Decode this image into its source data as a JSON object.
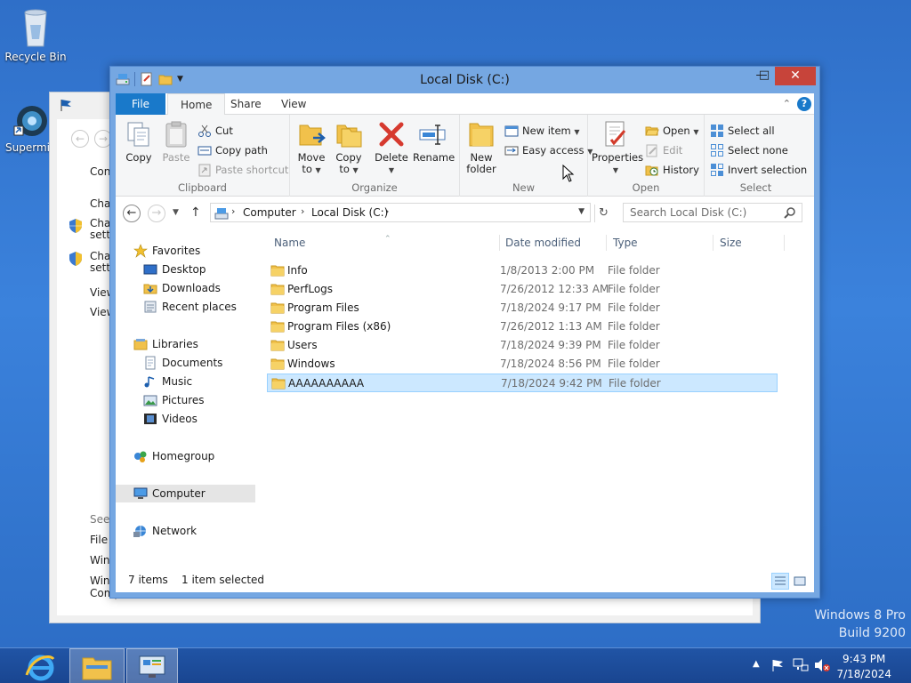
{
  "desktop": {
    "icons": [
      {
        "label": "Recycle Bin",
        "icon": "recycle-bin-icon"
      },
      {
        "label": "Supermi",
        "icon": "supermicro-icon"
      }
    ],
    "watermark": {
      "line1": "Windows 8 Pro",
      "line2": "Build 9200"
    }
  },
  "background_window": {
    "links": [
      "Contr",
      "Chang",
      "Chang settin",
      "Chang settin",
      "View a",
      "View p",
      "See al",
      "File H",
      "Windo",
      "Windo Comp"
    ]
  },
  "explorer": {
    "title": "Local Disk (C:)",
    "window_buttons": {
      "minimize": "—",
      "maximize": "□",
      "close": "✕"
    },
    "tabs": [
      "File",
      "Home",
      "Share",
      "View"
    ],
    "active_tab": "Home",
    "ribbon": {
      "clipboard": {
        "label": "Clipboard",
        "copy": "Copy",
        "paste": "Paste",
        "cut": "Cut",
        "copy_path": "Copy path",
        "paste_shortcut": "Paste shortcut"
      },
      "organize": {
        "label": "Organize",
        "move_to": "Move",
        "move_to_2": "to",
        "copy_to": "Copy",
        "copy_to_2": "to",
        "delete": "Delete",
        "rename": "Rename"
      },
      "new": {
        "label": "New",
        "new_folder": "New",
        "new_folder_2": "folder",
        "new_item": "New item",
        "easy_access": "Easy access"
      },
      "open": {
        "label": "Open",
        "properties": "Properties",
        "open": "Open",
        "edit": "Edit",
        "history": "History"
      },
      "select": {
        "label": "Select",
        "select_all": "Select all",
        "select_none": "Select none",
        "invert_selection": "Invert selection"
      }
    },
    "address": {
      "crumbs": [
        "Computer",
        "Local Disk (C:)"
      ]
    },
    "search": {
      "placeholder": "Search Local Disk (C:)"
    },
    "nav_pane": {
      "favorites": "Favorites",
      "desktop": "Desktop",
      "downloads": "Downloads",
      "recent_places": "Recent places",
      "libraries": "Libraries",
      "documents": "Documents",
      "music": "Music",
      "pictures": "Pictures",
      "videos": "Videos",
      "homegroup": "Homegroup",
      "computer": "Computer",
      "network": "Network"
    },
    "columns": {
      "name": "Name",
      "date": "Date modified",
      "type": "Type",
      "size": "Size"
    },
    "files": [
      {
        "name": "Info",
        "date": "1/8/2013 2:00 PM",
        "type": "File folder"
      },
      {
        "name": "PerfLogs",
        "date": "7/26/2012 12:33 AM",
        "type": "File folder"
      },
      {
        "name": "Program Files",
        "date": "7/18/2024 9:17 PM",
        "type": "File folder"
      },
      {
        "name": "Program Files (x86)",
        "date": "7/26/2012 1:13 AM",
        "type": "File folder"
      },
      {
        "name": "Users",
        "date": "7/18/2024 9:39 PM",
        "type": "File folder"
      },
      {
        "name": "Windows",
        "date": "7/18/2024 8:56 PM",
        "type": "File folder"
      },
      {
        "name": "AAAAAAAAAA",
        "date": "7/18/2024 9:42 PM",
        "type": "File folder",
        "selected": true
      }
    ],
    "status": {
      "items": "7 items",
      "selected": "1 item selected"
    }
  },
  "taskbar": {
    "clock_time": "9:43 PM",
    "clock_date": "7/18/2024"
  },
  "colors": {
    "accent": "#1979ca",
    "selection": "#cce8ff",
    "close": "#c7443a",
    "desktop": "#3b82dc"
  }
}
